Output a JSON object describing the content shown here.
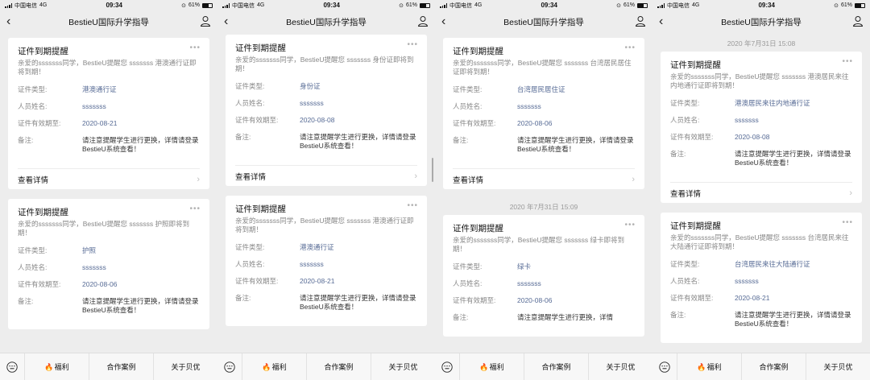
{
  "status_bar": {
    "carrier": "中国电信",
    "network": "4G",
    "time": "09:34",
    "battery": "61%"
  },
  "nav": {
    "title": "BestieU国际升学指导"
  },
  "labels": {
    "card_title": "证件到期提醒",
    "more": "•••",
    "type_label": "证件类型:",
    "name_label": "人员姓名:",
    "expiry_label": "证件有效期至:",
    "note_label": "备注:",
    "view_details": "查看详情",
    "chevron": "›"
  },
  "bottom_tabs": {
    "fire_icon": "🔥",
    "welfare": "福利",
    "cases": "合作案例",
    "about": "关于贝优"
  },
  "screens": [
    {
      "cards": [
        {
          "body": "亲爱的sssssss同学，BestieU提醒您 sssssss 港澳通行证即将到期！",
          "type": "港澳通行证",
          "name": "sssssss",
          "expiry": "2020-08-21",
          "note": "请注意提醒学生进行更换，详情请登录 BestieU系统查看！"
        },
        {
          "body": "亲爱的sssssss同学，BestieU提醒您 sssssss 护照即将到期！",
          "type": "护照",
          "name": "sssssss",
          "expiry": "2020-08-06",
          "note": "请注意提醒学生进行更换，详情请登录 BestieU系统查看！"
        }
      ]
    },
    {
      "cards": [
        {
          "body": "亲爱的sssssss同学，BestieU提醒您 sssssss 身份证即将到期！",
          "type": "身份证",
          "name": "sssssss",
          "expiry": "2020-08-08",
          "note": "请注意提醒学生进行更换，详情请登录 BestieU系统查看！"
        },
        {
          "body": "亲爱的sssssss同学，BestieU提醒您 sssssss 港澳通行证即将到期！",
          "type": "港澳通行证",
          "name": "sssssss",
          "expiry": "2020-08-21",
          "note": "请注意提醒学生进行更换，详情请登录 BestieU系统查看！"
        }
      ]
    },
    {
      "timestamp": "2020 年7月31日 15:09",
      "cards": [
        {
          "body": "亲爱的sssssss同学，BestieU提醒您 sssssss 台湾居民居住证即将到期！",
          "type": "台湾居民居住证",
          "name": "sssssss",
          "expiry": "2020-08-06",
          "note": "请注意提醒学生进行更换，详情请登录 BestieU系统查看！"
        },
        {
          "body": "亲爱的sssssss同学，BestieU提醒您 sssssss 绿卡即将到期！",
          "type": "绿卡",
          "name": "sssssss",
          "expiry": "2020-08-06",
          "note": "请注意提醒学生进行更换，详情"
        }
      ]
    },
    {
      "timestamp": "2020 年7月31日 15:08",
      "cards": [
        {
          "body": "亲爱的sssssss同学，BestieU提醒您 sssssss 港澳居民来往内地通行证即将到期！",
          "type": "港澳居民来往内地通行证",
          "name": "sssssss",
          "expiry": "2020-08-08",
          "note": "请注意提醒学生进行更换，详情请登录 BestieU系统查看！"
        },
        {
          "body": "亲爱的sssssss同学，BestieU提醒您 sssssss 台湾居民来往大陆通行证即将到期！",
          "type": "台湾居民来往大陆通行证",
          "name": "sssssss",
          "expiry": "2020-08-21",
          "note": "请注意提醒学生进行更换，详情请登录 BestieU系统查看！"
        }
      ]
    }
  ]
}
